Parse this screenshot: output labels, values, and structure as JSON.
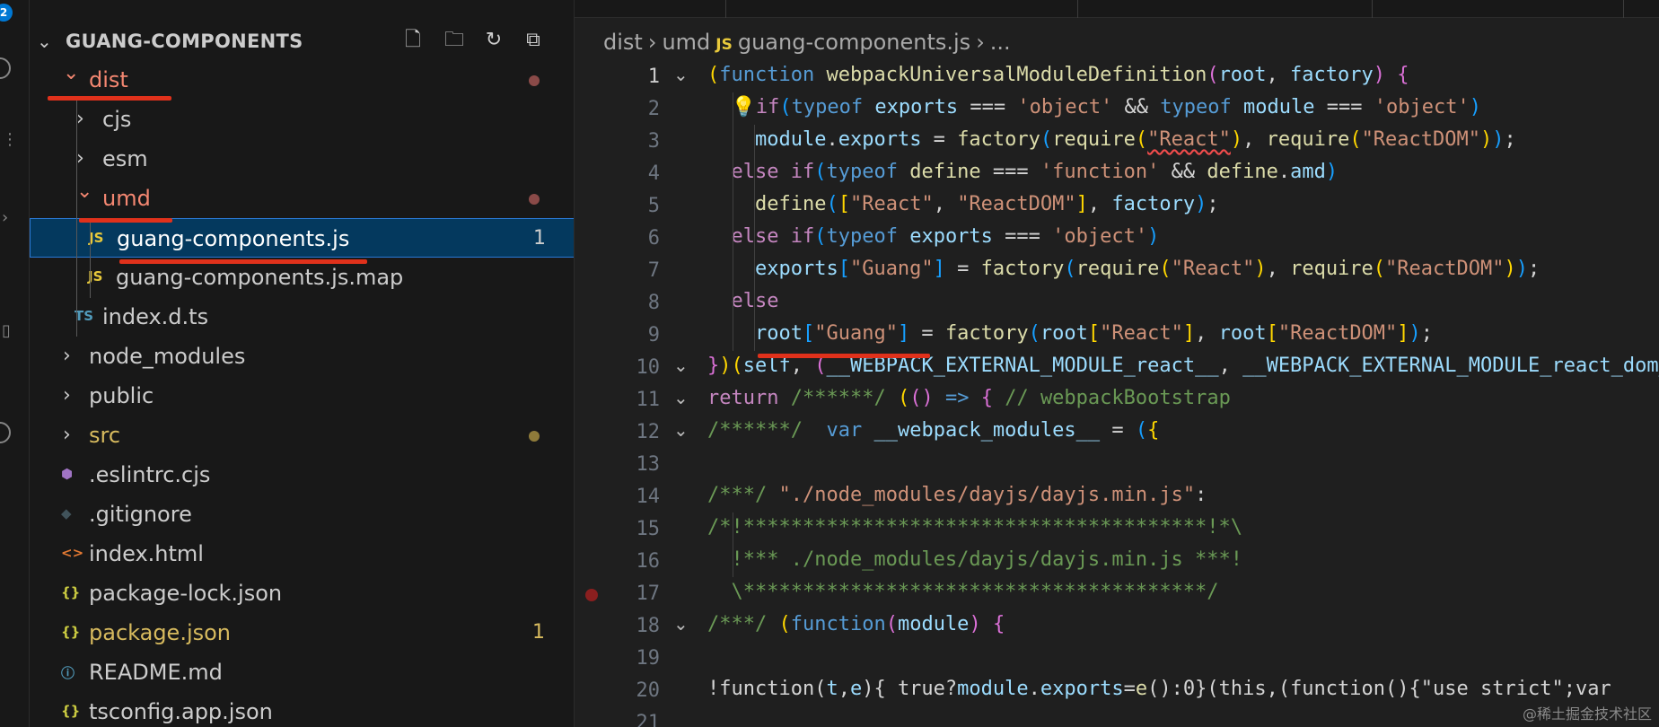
{
  "activity": {
    "badge": "2"
  },
  "explorer": {
    "title": "GUANG-COMPONENTS",
    "tree": [
      {
        "label": "dist",
        "color": "#f48771",
        "kind": "folder-open",
        "dot": "#8a4a48"
      },
      {
        "label": "cjs",
        "color": "#cccccc",
        "kind": "folder-closed"
      },
      {
        "label": "esm",
        "color": "#cccccc",
        "kind": "folder-closed"
      },
      {
        "label": "umd",
        "color": "#f48771",
        "kind": "folder-open",
        "dot": "#8a4a48"
      },
      {
        "label": "guang-components.js",
        "icon": "JS",
        "iconColor": "#e8c93b",
        "color": "#ffffff",
        "count": "1",
        "selected": true
      },
      {
        "label": "guang-components.js.map",
        "icon": "JS",
        "iconColor": "#e8c93b",
        "color": "#cccccc"
      },
      {
        "label": "index.d.ts",
        "icon": "TS",
        "iconColor": "#519aba",
        "color": "#cccccc"
      },
      {
        "label": "node_modules",
        "color": "#cccccc",
        "kind": "folder-closed"
      },
      {
        "label": "public",
        "color": "#cccccc",
        "kind": "folder-closed"
      },
      {
        "label": "src",
        "color": "#d7ba5e",
        "kind": "folder-closed",
        "dot": "#8f7b3a"
      },
      {
        "label": ".eslintrc.cjs",
        "icon": "⬢",
        "iconColor": "#a074c4",
        "color": "#cccccc"
      },
      {
        "label": ".gitignore",
        "icon": "◆",
        "iconColor": "#41535b",
        "color": "#cccccc"
      },
      {
        "label": "index.html",
        "icon": "<>",
        "iconColor": "#e37933",
        "color": "#cccccc"
      },
      {
        "label": "package-lock.json",
        "icon": "{}",
        "iconColor": "#cbcb41",
        "color": "#cccccc"
      },
      {
        "label": "package.json",
        "icon": "{}",
        "iconColor": "#cbcb41",
        "color": "#d7ba5e",
        "count": "1",
        "countColor": "#d7ba5e"
      },
      {
        "label": "README.md",
        "icon": "ⓘ",
        "iconColor": "#519aba",
        "color": "#cccccc"
      },
      {
        "label": "tsconfig.app.json",
        "icon": "{}",
        "iconColor": "#cbcb41",
        "color": "#cccccc"
      }
    ]
  },
  "breadcrumb": {
    "part1": "dist",
    "part2": "umd",
    "js": "JS",
    "file": "guang-components.js",
    "tail": "..."
  },
  "watermark": "@稀土掘金技术社区",
  "code": [
    {
      "n": "1",
      "fold": true,
      "active": true,
      "html": "<span class='p1'>(</span><span class='kw'>function</span> <span class='fn'>webpackUniversalModuleDefinition</span><span class='p2'>(</span><span class='var'>root</span>, <span class='var'>factory</span><span class='p2'>)</span> <span class='p2'>{</span>"
    },
    {
      "n": "2",
      "fold": false,
      "html": "  <span class='p1'>💡</span><span class='ctrl'>if</span><span class='p3'>(</span><span class='kw'>typeof</span> <span class='var'>exports</span> === <span class='str'>'object'</span> &amp;&amp; <span class='kw'>typeof</span> <span class='var'>module</span> === <span class='str'>'object'</span><span class='p3'>)</span>"
    },
    {
      "n": "3",
      "fold": false,
      "html": "    <span class='var'>module</span>.<span class='var'>exports</span> = <span class='fn'>factory</span><span class='p3'>(</span><span class='fn'>require</span><span class='p1'>(</span><span class='str squiggle'>\"React\"</span><span class='p1'>)</span>, <span class='fn'>require</span><span class='p1'>(</span><span class='str'>\"ReactDOM\"</span><span class='p1'>)</span><span class='p3'>)</span>;"
    },
    {
      "n": "4",
      "fold": false,
      "html": "  <span class='ctrl'>else if</span><span class='p3'>(</span><span class='kw'>typeof</span> <span class='fn'>define</span> === <span class='str'>'function'</span> &amp;&amp; <span class='fn'>define</span>.<span class='var'>amd</span><span class='p3'>)</span>"
    },
    {
      "n": "5",
      "fold": false,
      "html": "    <span class='fn'>define</span><span class='p3'>(</span><span class='p1'>[</span><span class='str'>\"React\"</span>, <span class='str'>\"ReactDOM\"</span><span class='p1'>]</span>, <span class='var'>factory</span><span class='p3'>)</span>;"
    },
    {
      "n": "6",
      "fold": false,
      "html": "  <span class='ctrl'>else if</span><span class='p3'>(</span><span class='kw'>typeof</span> <span class='var'>exports</span> === <span class='str'>'object'</span><span class='p3'>)</span>"
    },
    {
      "n": "7",
      "fold": false,
      "html": "    <span class='var'>exports</span><span class='p3'>[</span><span class='str'>\"Guang\"</span><span class='p3'>]</span> = <span class='fn'>factory</span><span class='p3'>(</span><span class='fn'>require</span><span class='p1'>(</span><span class='str'>\"React\"</span><span class='p1'>)</span>, <span class='fn'>require</span><span class='p1'>(</span><span class='str'>\"ReactDOM\"</span><span class='p1'>)</span><span class='p3'>)</span>;"
    },
    {
      "n": "8",
      "fold": false,
      "html": "  <span class='ctrl'>else</span>"
    },
    {
      "n": "9",
      "fold": false,
      "html": "    <span class='var'>root</span><span class='p3'>[</span><span class='str'>\"Guang\"</span><span class='p3'>]</span> = <span class='fn'>factory</span><span class='p3'>(</span><span class='var'>root</span><span class='p1'>[</span><span class='str'>\"React\"</span><span class='p1'>]</span>, <span class='var'>root</span><span class='p1'>[</span><span class='str'>\"ReactDOM\"</span><span class='p1'>]</span><span class='p3'>)</span>;"
    },
    {
      "n": "10",
      "fold": true,
      "html": "<span class='p2'>}</span><span class='p1'>)</span><span class='p1'>(</span><span class='var'>self</span>, <span class='p2'>(</span><span class='var'>__WEBPACK_EXTERNAL_MODULE_react__</span>, <span class='var'>__WEBPACK_EXTERNAL_MODULE_react_dom__</span>"
    },
    {
      "n": "11",
      "fold": true,
      "html": "<span class='ctrl'>return</span> <span class='cmt'>/******/</span> <span class='p1'>(</span><span class='p2'>()</span> <span class='kw'>=&gt;</span> <span class='p2'>{</span> <span class='cmt'>// webpackBootstrap</span>"
    },
    {
      "n": "12",
      "fold": true,
      "html": "<span class='cmt'>/******/</span>  <span class='kw'>var</span> <span class='var'>__webpack_modules__</span> = <span class='p3'>(</span><span class='p1'>{</span>"
    },
    {
      "n": "13",
      "fold": false,
      "html": ""
    },
    {
      "n": "14",
      "fold": false,
      "html": "<span class='cmt'>/***/</span> <span class='str'>\"./node_modules/dayjs/dayjs.min.js\"</span>:"
    },
    {
      "n": "15",
      "fold": false,
      "html": "<span class='cmt'>/*!***************************************!*\\</span>"
    },
    {
      "n": "16",
      "fold": false,
      "html": "<span class='cmt'>  !*** ./node_modules/dayjs/dayjs.min.js ***!</span>"
    },
    {
      "n": "17",
      "fold": false,
      "bp": true,
      "html": "<span class='cmt'>  \\***************************************/</span>"
    },
    {
      "n": "18",
      "fold": true,
      "html": "<span class='cmt'>/***/</span> <span class='p1'>(</span><span class='kw'>function</span><span class='p2'>(</span><span class='var'>module</span><span class='p2'>)</span> <span class='p2'>{</span>"
    },
    {
      "n": "19",
      "fold": false,
      "html": ""
    },
    {
      "n": "20",
      "fold": false,
      "html": "!function(<span class='var'>t</span>,<span class='var'>e</span>){ true?<span class='var'>module</span>.<span class='var'>exports</span>=<span class='fn'>e</span>():0}(this,(function(){\"use strict\";var"
    },
    {
      "n": "21",
      "fold": false,
      "html": ""
    }
  ]
}
